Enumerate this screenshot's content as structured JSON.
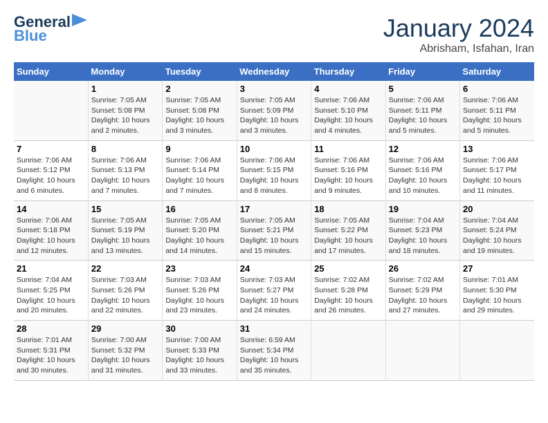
{
  "logo": {
    "line1": "General",
    "line2": "Blue"
  },
  "title": "January 2024",
  "subtitle": "Abrisham, Isfahan, Iran",
  "weekdays": [
    "Sunday",
    "Monday",
    "Tuesday",
    "Wednesday",
    "Thursday",
    "Friday",
    "Saturday"
  ],
  "weeks": [
    [
      null,
      {
        "day": "1",
        "sunrise": "7:05 AM",
        "sunset": "5:08 PM",
        "daylight": "10 hours and 2 minutes."
      },
      {
        "day": "2",
        "sunrise": "7:05 AM",
        "sunset": "5:08 PM",
        "daylight": "10 hours and 3 minutes."
      },
      {
        "day": "3",
        "sunrise": "7:05 AM",
        "sunset": "5:09 PM",
        "daylight": "10 hours and 3 minutes."
      },
      {
        "day": "4",
        "sunrise": "7:06 AM",
        "sunset": "5:10 PM",
        "daylight": "10 hours and 4 minutes."
      },
      {
        "day": "5",
        "sunrise": "7:06 AM",
        "sunset": "5:11 PM",
        "daylight": "10 hours and 5 minutes."
      },
      {
        "day": "6",
        "sunrise": "7:06 AM",
        "sunset": "5:11 PM",
        "daylight": "10 hours and 5 minutes."
      }
    ],
    [
      {
        "day": "7",
        "sunrise": "7:06 AM",
        "sunset": "5:12 PM",
        "daylight": "10 hours and 6 minutes."
      },
      {
        "day": "8",
        "sunrise": "7:06 AM",
        "sunset": "5:13 PM",
        "daylight": "10 hours and 7 minutes."
      },
      {
        "day": "9",
        "sunrise": "7:06 AM",
        "sunset": "5:14 PM",
        "daylight": "10 hours and 7 minutes."
      },
      {
        "day": "10",
        "sunrise": "7:06 AM",
        "sunset": "5:15 PM",
        "daylight": "10 hours and 8 minutes."
      },
      {
        "day": "11",
        "sunrise": "7:06 AM",
        "sunset": "5:16 PM",
        "daylight": "10 hours and 9 minutes."
      },
      {
        "day": "12",
        "sunrise": "7:06 AM",
        "sunset": "5:16 PM",
        "daylight": "10 hours and 10 minutes."
      },
      {
        "day": "13",
        "sunrise": "7:06 AM",
        "sunset": "5:17 PM",
        "daylight": "10 hours and 11 minutes."
      }
    ],
    [
      {
        "day": "14",
        "sunrise": "7:06 AM",
        "sunset": "5:18 PM",
        "daylight": "10 hours and 12 minutes."
      },
      {
        "day": "15",
        "sunrise": "7:05 AM",
        "sunset": "5:19 PM",
        "daylight": "10 hours and 13 minutes."
      },
      {
        "day": "16",
        "sunrise": "7:05 AM",
        "sunset": "5:20 PM",
        "daylight": "10 hours and 14 minutes."
      },
      {
        "day": "17",
        "sunrise": "7:05 AM",
        "sunset": "5:21 PM",
        "daylight": "10 hours and 15 minutes."
      },
      {
        "day": "18",
        "sunrise": "7:05 AM",
        "sunset": "5:22 PM",
        "daylight": "10 hours and 17 minutes."
      },
      {
        "day": "19",
        "sunrise": "7:04 AM",
        "sunset": "5:23 PM",
        "daylight": "10 hours and 18 minutes."
      },
      {
        "day": "20",
        "sunrise": "7:04 AM",
        "sunset": "5:24 PM",
        "daylight": "10 hours and 19 minutes."
      }
    ],
    [
      {
        "day": "21",
        "sunrise": "7:04 AM",
        "sunset": "5:25 PM",
        "daylight": "10 hours and 20 minutes."
      },
      {
        "day": "22",
        "sunrise": "7:03 AM",
        "sunset": "5:26 PM",
        "daylight": "10 hours and 22 minutes."
      },
      {
        "day": "23",
        "sunrise": "7:03 AM",
        "sunset": "5:26 PM",
        "daylight": "10 hours and 23 minutes."
      },
      {
        "day": "24",
        "sunrise": "7:03 AM",
        "sunset": "5:27 PM",
        "daylight": "10 hours and 24 minutes."
      },
      {
        "day": "25",
        "sunrise": "7:02 AM",
        "sunset": "5:28 PM",
        "daylight": "10 hours and 26 minutes."
      },
      {
        "day": "26",
        "sunrise": "7:02 AM",
        "sunset": "5:29 PM",
        "daylight": "10 hours and 27 minutes."
      },
      {
        "day": "27",
        "sunrise": "7:01 AM",
        "sunset": "5:30 PM",
        "daylight": "10 hours and 29 minutes."
      }
    ],
    [
      {
        "day": "28",
        "sunrise": "7:01 AM",
        "sunset": "5:31 PM",
        "daylight": "10 hours and 30 minutes."
      },
      {
        "day": "29",
        "sunrise": "7:00 AM",
        "sunset": "5:32 PM",
        "daylight": "10 hours and 31 minutes."
      },
      {
        "day": "30",
        "sunrise": "7:00 AM",
        "sunset": "5:33 PM",
        "daylight": "10 hours and 33 minutes."
      },
      {
        "day": "31",
        "sunrise": "6:59 AM",
        "sunset": "5:34 PM",
        "daylight": "10 hours and 35 minutes."
      },
      null,
      null,
      null
    ]
  ]
}
